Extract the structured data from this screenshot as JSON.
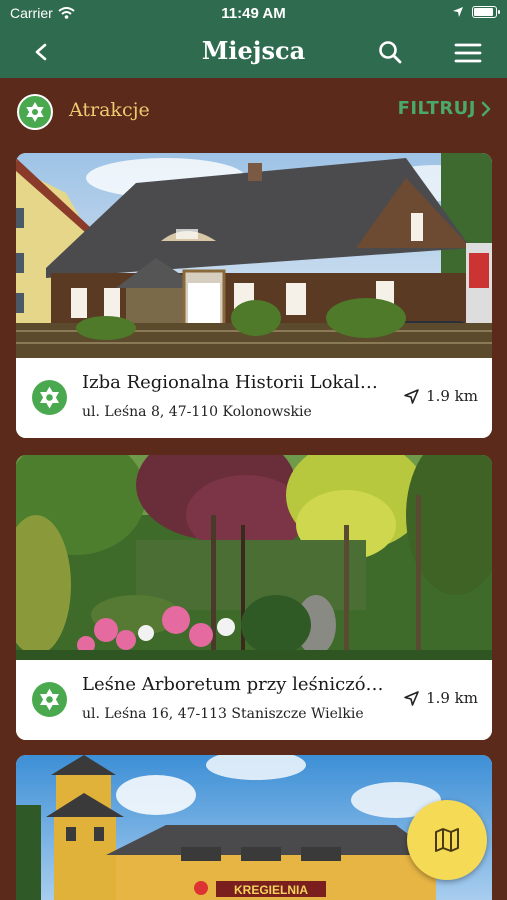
{
  "status_bar": {
    "carrier": "Carrier",
    "time": "11:49 AM",
    "battery_level": 0.9
  },
  "nav": {
    "title": "Miejsca",
    "back_icon": "chevron-left-icon",
    "search_icon": "search-icon",
    "menu_icon": "hamburger-menu-icon"
  },
  "filter_bar": {
    "category": "Atrakcje",
    "category_icon": "star-badge-icon",
    "filter_label": "FILTRUJ",
    "filter_icon": "chevron-right-icon"
  },
  "places": [
    {
      "name": "Izba Regionalna Historii Lokalnej",
      "address": "ul. Leśna 8, 47-110 Kolonowskie",
      "distance": "1.9 km"
    },
    {
      "name": "Leśne Arboretum przy leśniczówce",
      "address": "ul. Leśna 16, 47-113 Staniszcze Wielkie",
      "distance": "1.9 km"
    },
    {
      "name": "",
      "address": "",
      "distance": "",
      "photo_sign": "KREGIELNIA"
    }
  ],
  "fab": {
    "icon": "map-icon"
  },
  "colors": {
    "header": "#2f6b4f",
    "background": "#5b2a1a",
    "accent_green": "#4aa84f",
    "category_text": "#f0c870",
    "filter_text": "#4aa86a",
    "fab": "#f5da56"
  }
}
